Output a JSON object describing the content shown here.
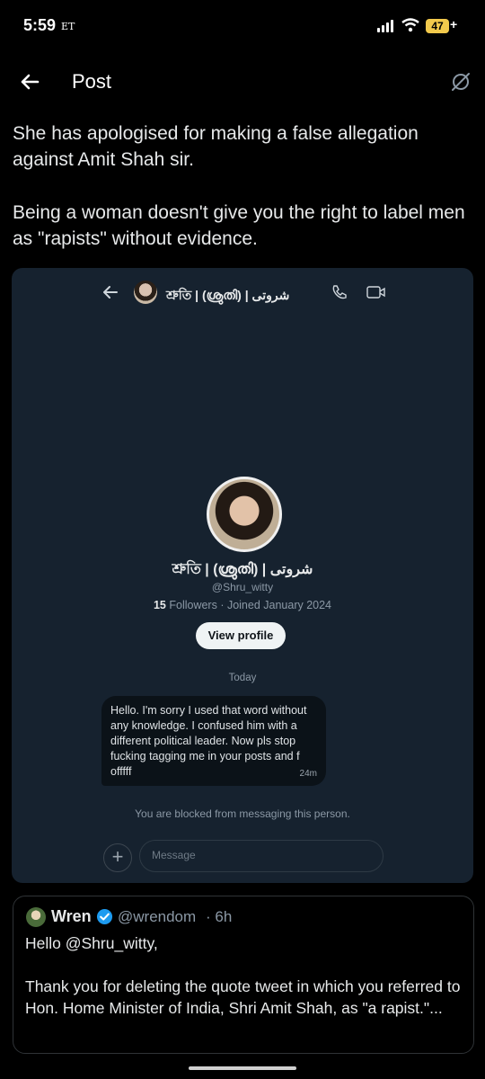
{
  "status_bar": {
    "time": "5:59",
    "carrier": "ET",
    "battery": "47",
    "battery_suffix": "+"
  },
  "header": {
    "title": "Post"
  },
  "tweet": {
    "paragraph1": "She has apologised for making a false allegation against Amit Shah sir.",
    "paragraph2": "Being a woman doesn't give you the right to label men as \"rapists\" without evidence."
  },
  "screenshot": {
    "dm_header_name": "শ্রুতি | (ശ്രുതി) | شروتی",
    "profile_name": "শ্রুতি | (ശ്രുതി) | شروتی",
    "handle": "@Shru_witty",
    "followers_count": "15",
    "followers_label": "Followers · Joined January 2024",
    "view_profile": "View profile",
    "date_label": "Today",
    "message": "Hello. I'm sorry I used that word without any knowledge. I confused him with a different political leader. Now pls stop fucking tagging me in your posts and f offfff",
    "message_time": "24m",
    "blocked_notice": "You are blocked from messaging this person.",
    "input_placeholder": "Message"
  },
  "quote": {
    "name": "Wren",
    "handle": "@wrendom",
    "time": "· 6h",
    "line1": "Hello @Shru_witty,",
    "body": "Thank you for deleting the quote tweet in which you referred to Hon. Home Minister of India, Shri Amit Shah, as \"a rapist.\"..."
  },
  "colors": {
    "background": "#000000",
    "card": "#16222f",
    "verified": "#1d9bf0",
    "battery": "#f2c94c"
  },
  "icons": [
    "back-arrow-icon",
    "grok-icon",
    "phone-icon",
    "video-icon",
    "plus-icon",
    "verified-icon",
    "signal-icon",
    "wifi-icon"
  ]
}
